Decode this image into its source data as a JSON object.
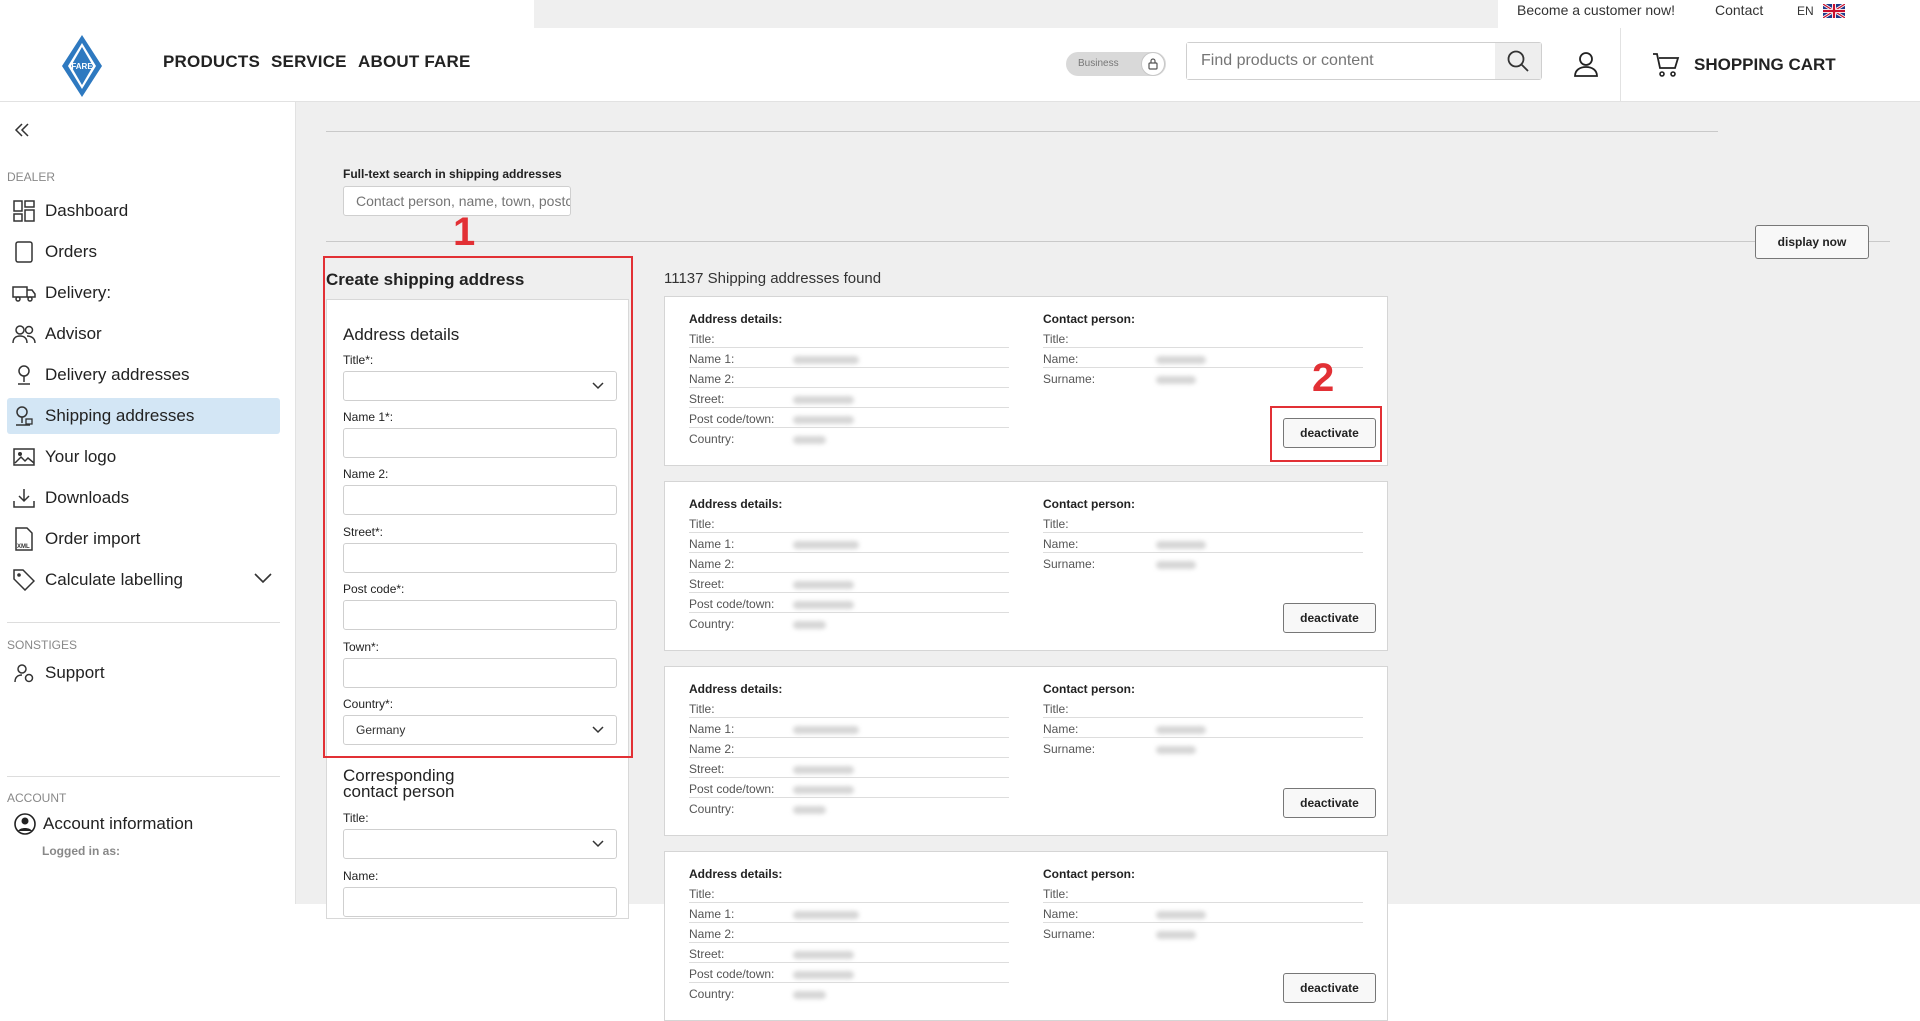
{
  "topbar": {
    "become_customer": "Become a customer now!",
    "contact": "Contact",
    "language": "EN"
  },
  "header": {
    "logo_text": "FARE",
    "nav": [
      "PRODUCTS",
      "SERVICE",
      "ABOUT FARE"
    ],
    "toggle_label": "Business",
    "search_placeholder": "Find products or content",
    "cart_label": "SHOPPING CART"
  },
  "sidebar": {
    "section_dealer": "DEALER",
    "items": [
      "Dashboard",
      "Orders",
      "Delivery:",
      "Advisor",
      "Delivery addresses",
      "Shipping addresses",
      "Your logo",
      "Downloads",
      "Order import",
      "Calculate labelling"
    ],
    "active_item": "Shipping addresses",
    "section_other": "SONSTIGES",
    "support": "Support",
    "section_account": "ACCOUNT",
    "account_info": "Account information",
    "logged_in_as": "Logged in as:"
  },
  "main": {
    "fulltext_label": "Full-text search in shipping addresses",
    "fulltext_placeholder": "Contact person, name, town, postcode",
    "display_button": "display now",
    "annotation_1": "1",
    "annotation_2": "2",
    "create_title": "Create shipping address",
    "address_details": "Address details",
    "labels": {
      "title": "Title*:",
      "name1": "Name 1*:",
      "name2": "Name 2:",
      "street": "Street*:",
      "postcode": "Post code*:",
      "town": "Town*:",
      "country": "Country*:"
    },
    "country_value": "Germany",
    "contact_section": "Corresponding\ncontact person",
    "contact_title": "Title:",
    "contact_name": "Name:",
    "count_text": "11137 Shipping addresses found",
    "card": {
      "address_head": "Address details:",
      "contact_head": "Contact person:",
      "addr_labels": [
        "Title:",
        "Name 1:",
        "Name 2:",
        "Street:",
        "Post code/town:",
        "Country:"
      ],
      "contact_labels": [
        "Title:",
        "Name:",
        "Surname:"
      ],
      "button": "deactivate"
    }
  }
}
